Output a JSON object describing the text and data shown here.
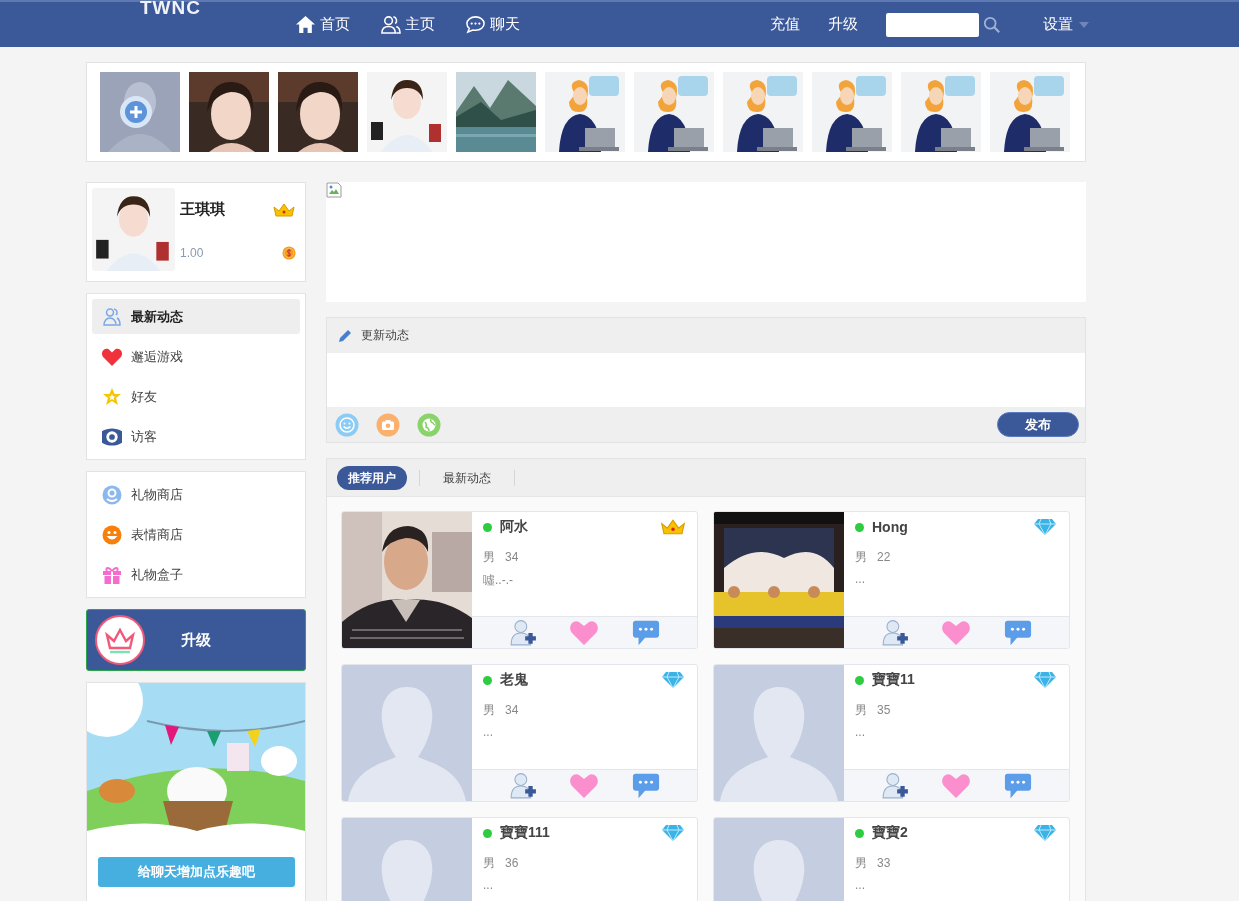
{
  "header": {
    "logo": "TWNC",
    "nav": [
      {
        "label": "首页"
      },
      {
        "label": "主页"
      },
      {
        "label": "聊天"
      }
    ],
    "links": [
      "充值",
      "升级"
    ],
    "settings": "设置"
  },
  "stories": [
    {
      "kind": "add"
    },
    {
      "kind": "picture"
    },
    {
      "kind": "picture"
    },
    {
      "kind": "picture"
    },
    {
      "kind": "picture"
    },
    {
      "kind": "picture"
    },
    {
      "kind": "picture"
    },
    {
      "kind": "picture"
    },
    {
      "kind": "picture"
    },
    {
      "kind": "picture"
    },
    {
      "kind": "picture"
    }
  ],
  "profile": {
    "name": "王琪琪",
    "badge": {
      "kind": "crown"
    },
    "balance": "1.00"
  },
  "menu": [
    {
      "label": "最新动态",
      "selected": true
    },
    {
      "label": "邂逅游戏",
      "selected": false
    },
    {
      "label": "好友",
      "selected": false
    },
    {
      "label": "访客",
      "selected": false
    }
  ],
  "shop_menu": [
    {
      "label": "礼物商店",
      "selected": false
    },
    {
      "label": "表情商店",
      "selected": false
    },
    {
      "label": "礼物盒子",
      "selected": false
    }
  ],
  "upgrade": {
    "label": "升级"
  },
  "sticker_store": {
    "button": "给聊天增加点乐趣吧"
  },
  "composer": {
    "title": "更新动态",
    "submit": "发布"
  },
  "tabs": [
    {
      "label": "推荐用户",
      "selected": true
    },
    {
      "label": "最新动态",
      "selected": false
    }
  ],
  "users": [
    {
      "name": "阿水",
      "online": true,
      "badge": {
        "kind": "crown"
      },
      "gender": "男",
      "age": "34",
      "bio": "噓..-.-"
    },
    {
      "name": "Hong",
      "online": true,
      "badge": {
        "kind": "diamond"
      },
      "gender": "男",
      "age": "22",
      "bio": "..."
    },
    {
      "kind": "default",
      "name": "老鬼",
      "online": true,
      "badge": {
        "kind": "diamond"
      },
      "gender": "男",
      "age": "34",
      "bio": "..."
    },
    {
      "kind": "default",
      "name": "寶寶11",
      "online": true,
      "badge": {
        "kind": "diamond"
      },
      "gender": "男",
      "age": "35",
      "bio": "..."
    },
    {
      "kind": "default",
      "name": "寶寶111",
      "online": true,
      "badge": {
        "kind": "diamond"
      },
      "gender": "男",
      "age": "36",
      "bio": "..."
    },
    {
      "kind": "default",
      "name": "寶寶2",
      "online": true,
      "badge": {
        "kind": "diamond"
      },
      "gender": "男",
      "age": "33",
      "bio": "..."
    }
  ]
}
